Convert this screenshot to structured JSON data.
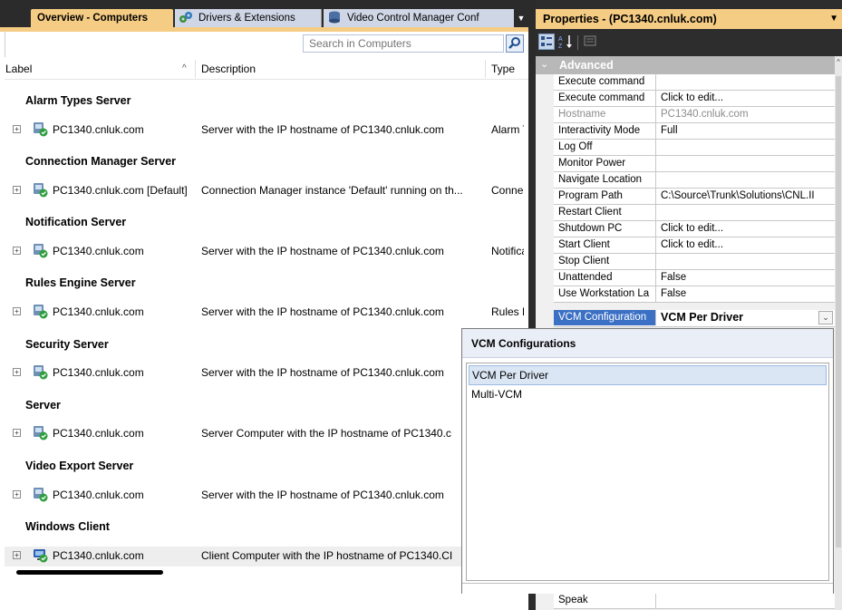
{
  "document_tabs": [
    {
      "label": "Overview - Computers",
      "active": true
    },
    {
      "label": "Drivers & Extensions",
      "icon": "gears-icon"
    },
    {
      "label": "Video Control Manager Conf",
      "icon": "database-icon"
    }
  ],
  "search": {
    "placeholder": "Search in Computers",
    "value": ""
  },
  "grid": {
    "columns": {
      "label": "Label",
      "description": "Description",
      "type": "Type"
    },
    "groups": [
      {
        "name": "Alarm Types Server",
        "row": {
          "label": "PC1340.cnluk.com",
          "description": "Server with the IP hostname of PC1340.cnluk.com",
          "type": "Alarm T"
        }
      },
      {
        "name": "Connection Manager Server",
        "row": {
          "label": "PC1340.cnluk.com [Default]",
          "description": "Connection Manager instance 'Default' running on th...",
          "type": "Conne"
        }
      },
      {
        "name": "Notification Server",
        "row": {
          "label": "PC1340.cnluk.com",
          "description": "Server with the IP hostname of PC1340.cnluk.com",
          "type": "Notifica"
        }
      },
      {
        "name": "Rules Engine Server",
        "row": {
          "label": "PC1340.cnluk.com",
          "description": "Server with the IP hostname of PC1340.cnluk.com",
          "type": "Rules E"
        }
      },
      {
        "name": "Security Server",
        "row": {
          "label": "PC1340.cnluk.com",
          "description": "Server with the IP hostname of PC1340.cnluk.com",
          "type": ""
        }
      },
      {
        "name": "Server",
        "row": {
          "label": "PC1340.cnluk.com",
          "description": "Server Computer with the IP hostname of PC1340.c",
          "type": ""
        }
      },
      {
        "name": "Video Export Server",
        "row": {
          "label": "PC1340.cnluk.com",
          "description": "Server with the IP hostname of PC1340.cnluk.com",
          "type": ""
        }
      },
      {
        "name": "Windows Client",
        "row": {
          "label": "PC1340.cnluk.com",
          "description": "Client Computer with the IP hostname of PC1340.CI",
          "type": ""
        }
      }
    ]
  },
  "properties": {
    "title": "Properties - (PC1340.cnluk.com)",
    "category": "Advanced",
    "rows": [
      {
        "name": "Execute command",
        "value": ""
      },
      {
        "name": "Execute command",
        "value": "Click to edit..."
      },
      {
        "name": "Hostname",
        "value": "PC1340.cnluk.com",
        "readonly": true
      },
      {
        "name": "Interactivity Mode",
        "value": "Full"
      },
      {
        "name": "Log Off",
        "value": ""
      },
      {
        "name": "Monitor Power",
        "value": ""
      },
      {
        "name": "Navigate Location",
        "value": ""
      },
      {
        "name": "Program Path",
        "value": "C:\\Source\\Trunk\\Solutions\\CNL.II"
      },
      {
        "name": "Restart Client",
        "value": ""
      },
      {
        "name": "Shutdown PC",
        "value": "Click to edit..."
      },
      {
        "name": "Start Client",
        "value": "Click to edit..."
      },
      {
        "name": "Stop Client",
        "value": ""
      },
      {
        "name": "Unattended",
        "value": "False"
      },
      {
        "name": "Use Workstation La",
        "value": "False"
      },
      {
        "name": "VCM Configuration",
        "value": "VCM Per Driver",
        "selected": true
      }
    ],
    "bottom_row": {
      "name": "Speak",
      "value": ""
    }
  },
  "vcm_popup": {
    "header": "VCM Configurations",
    "options": [
      {
        "label": "VCM Per Driver",
        "selected": true
      },
      {
        "label": "Multi-VCM",
        "selected": false
      }
    ]
  },
  "colors": {
    "accent_gold": "#f5cc84",
    "dark_chrome": "#2b2b2b",
    "selection_blue": "#3b70c4"
  }
}
